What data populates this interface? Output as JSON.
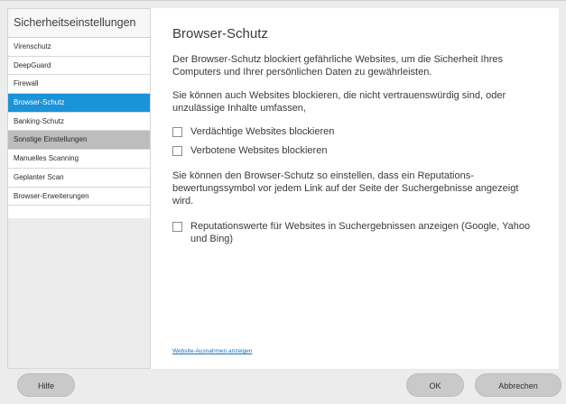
{
  "sidebar": {
    "title": "Sicherheitseinstellungen",
    "items": [
      {
        "label": "Virenschutz"
      },
      {
        "label": "DeepGuard"
      },
      {
        "label": "Firewall"
      },
      {
        "label": "Browser-Schutz"
      },
      {
        "label": "Banking-Schutz"
      },
      {
        "label": "Sonstige Einstellungen"
      },
      {
        "label": "Manuelles Scanning"
      },
      {
        "label": "Geplanter Scan"
      },
      {
        "label": "Browser-Erweiterungen"
      }
    ],
    "selected": "Browser-Schutz"
  },
  "main": {
    "title": "Browser-Schutz",
    "para1": "Der Browser-Schutz blockiert gefährliche Websites, um die Sicherheit Ihres Computers und Ihrer persönlichen Daten zu gewährleisten.",
    "para2": "Sie können auch Websites blockieren, die nicht vertrauenswürdig sind, oder unzulässige Inhalte umfassen,",
    "check_suspicious": "Verdächtige Websites blockieren",
    "check_forbidden": "Verbotene Websites blockieren",
    "para3": "Sie können den Browser-Schutz so einstellen, dass ein  Reputations-bewertungssymbol vor jedem Link auf der Seite der Suchergebnisse angezeigt wird.",
    "check_reputation": "Reputationswerte für Websites in Suchergebnissen anzeigen (Google, Yahoo und Bing)",
    "exceptions_link": "Website-Ausnahmen anzeigen"
  },
  "buttons": {
    "help": "Hilfe",
    "ok": "OK",
    "cancel": "Abbrechen"
  },
  "colors": {
    "selected": "#1a93d8",
    "section_header": "#bdbdbd",
    "link": "#1a6fb5"
  }
}
